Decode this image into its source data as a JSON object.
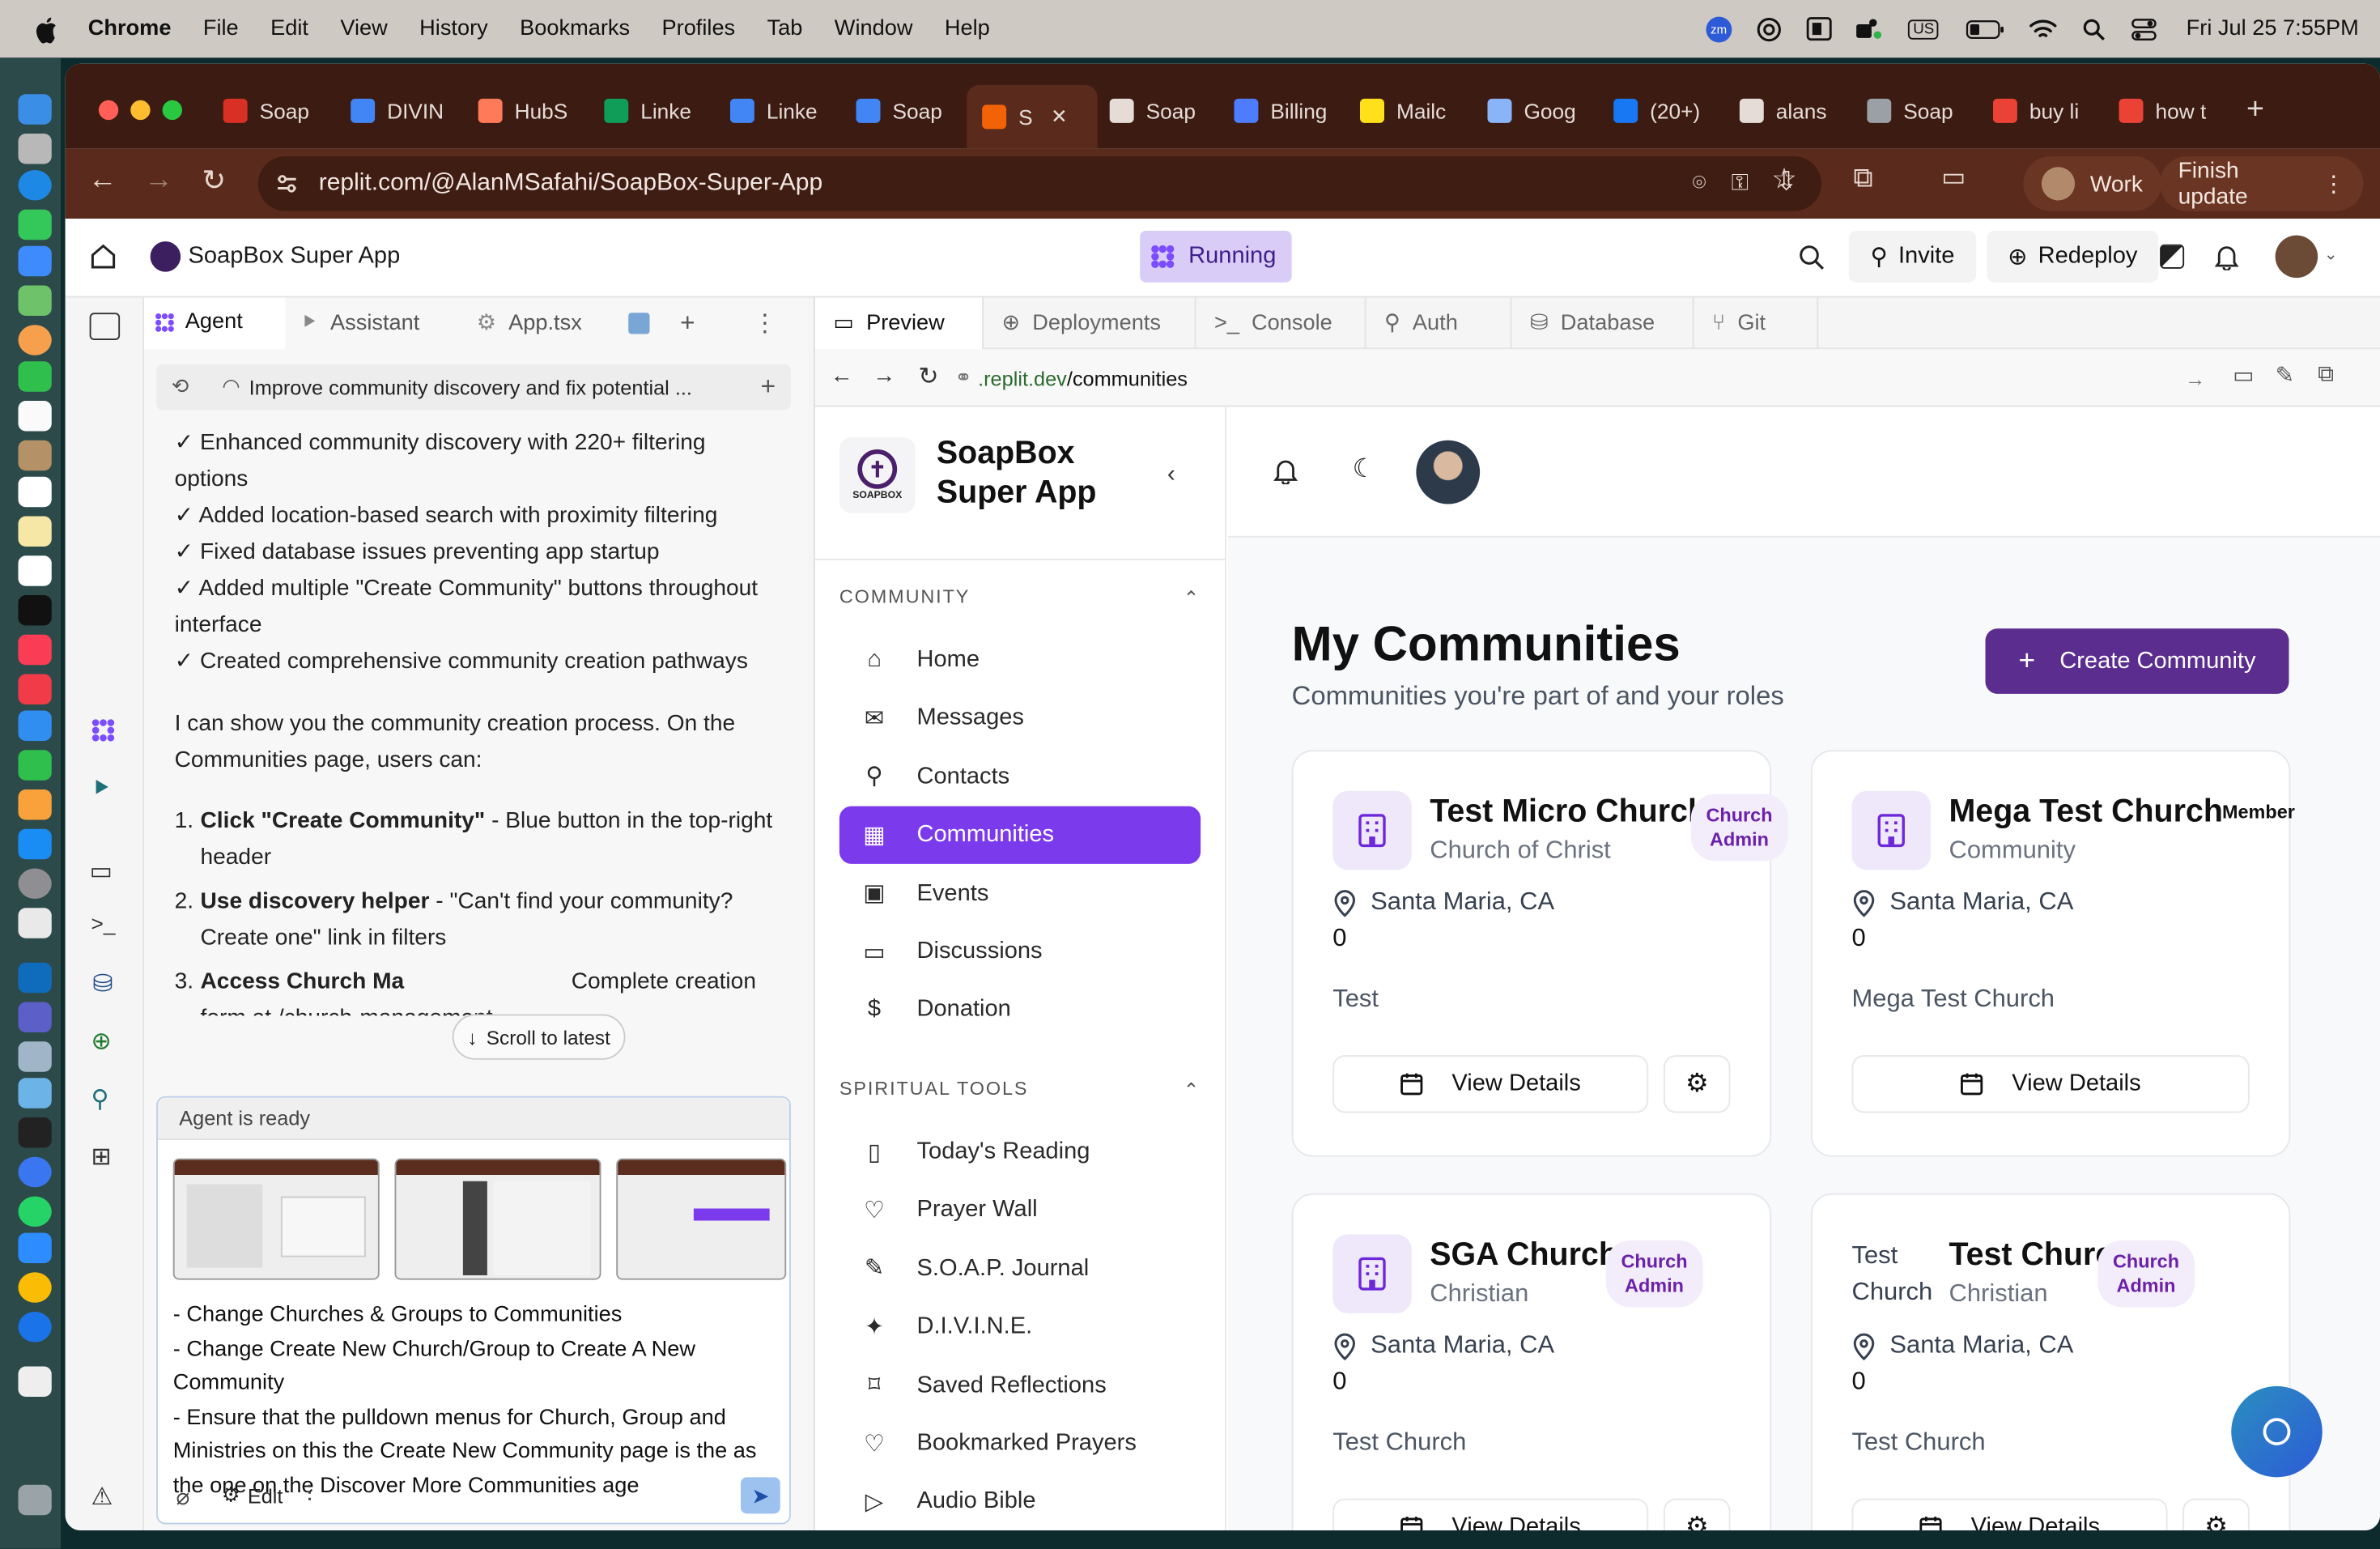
{
  "menubar": {
    "app": "Chrome",
    "items": [
      "File",
      "Edit",
      "View",
      "History",
      "Bookmarks",
      "Profiles",
      "Tab",
      "Window",
      "Help"
    ],
    "status": {
      "zoom_badge": "zm",
      "input_source": "US",
      "datetime": "Fri Jul 25  7:55PM"
    }
  },
  "tabs": [
    {
      "label": "Soap",
      "color": "#d93025"
    },
    {
      "label": "DIVIN",
      "color": "#4285f4"
    },
    {
      "label": "HubS",
      "color": "#ff7a59"
    },
    {
      "label": "Linke",
      "color": "#0f9d58"
    },
    {
      "label": "Linke",
      "color": "#4285f4"
    },
    {
      "label": "Soap",
      "color": "#4285f4"
    },
    {
      "label": "S",
      "color": "#f26207"
    },
    {
      "label": "Soap",
      "color": "#e6dcd7"
    },
    {
      "label": "Billing",
      "color": "#4d7cfe"
    },
    {
      "label": "Mailc",
      "color": "#ffe01b"
    },
    {
      "label": "Goog",
      "color": "#8ab4f8"
    },
    {
      "label": "(20+)",
      "color": "#1877f2"
    },
    {
      "label": "alans",
      "color": "#e6dcd7"
    },
    {
      "label": "Soap",
      "color": "#9aa0a6"
    },
    {
      "label": "buy li",
      "color": "#ea4335"
    },
    {
      "label": "how t",
      "color": "#ea4335"
    }
  ],
  "toolbar": {
    "url": "replit.com/@AlanMSafahi/SoapBox-Super-App",
    "profile_label": "Work",
    "update_label": "Finish update"
  },
  "replit": {
    "project": "SoapBox Super App",
    "status": "Running",
    "invite": "Invite",
    "redeploy": "Redeploy"
  },
  "agent": {
    "tabs": [
      "Agent",
      "Assistant",
      "App.tsx"
    ],
    "thread_title": "Improve community discovery and fix potential ...",
    "checklist": [
      "✓ Enhanced community discovery with 220+ filtering options",
      "✓ Added location-based search with proximity filtering",
      "✓ Fixed database issues preventing app startup",
      "✓ Added multiple \"Create Community\" buttons throughout interface",
      "✓ Created comprehensive community creation pathways"
    ],
    "intro": "I can show you the community creation process. On the Communities page, users can:",
    "steps": [
      {
        "n": "1.",
        "bold": "Click \"Create Community\"",
        "rest": " - Blue button in the top-right header"
      },
      {
        "n": "2.",
        "bold": "Use discovery helper",
        "rest": " - \"Can't find your community? Create one\" link in filters"
      },
      {
        "n": "3.",
        "bold": "Access Church Ma",
        "rest": " Complete creation form at /church-management"
      }
    ],
    "scroll_label": "Scroll to latest",
    "ready": "Agent is ready",
    "draft": [
      "- Change Churches & Groups to Communities",
      "- Change Create New Church/Group to Create A New Community",
      "- Ensure that the pulldown menus for Church, Group and Ministries on this the Create New Community page  is the as the one on the Discover More Communities age"
    ],
    "edit_label": "Edit"
  },
  "preview": {
    "tabs": [
      "Preview",
      "Deployments",
      "Console",
      "Auth",
      "Database",
      "Git"
    ],
    "address_domain": ".replit.dev",
    "address_path": "/communities"
  },
  "app": {
    "brand_line1": "SoapBox",
    "brand_line2": "Super App",
    "logo_text": "SOAPBOX",
    "community_heading": "COMMUNITY",
    "community_items": [
      "Home",
      "Messages",
      "Contacts",
      "Communities",
      "Events",
      "Discussions",
      "Donation"
    ],
    "tools_heading": "SPIRITUAL TOOLS",
    "tools_items": [
      "Today's Reading",
      "Prayer Wall",
      "S.O.A.P. Journal",
      "D.I.V.I.N.E.",
      "Saved Reflections",
      "Bookmarked Prayers",
      "Audio Bible"
    ],
    "page_title": "My Communities",
    "page_subtitle": "Communities you're part of and your roles",
    "create_button": "Create Community",
    "accent": "#5b2d8e",
    "active_nav": "#7c3aed"
  },
  "cards": [
    {
      "name": "Test Micro Church",
      "type": "Church of Christ",
      "role_line1": "Church",
      "role_line2": "Admin",
      "location": "Santa Maria, CA",
      "count": "0",
      "description": "Test",
      "button": "View Details"
    },
    {
      "name": "Mega Test Church",
      "type": "Community",
      "role_line1": "Member",
      "role_line2": "",
      "location": "Santa Maria, CA",
      "count": "0",
      "description": "Mega Test Church",
      "button": "View Details"
    },
    {
      "name": "SGA Church",
      "type": "Christian",
      "role_line1": "Church",
      "role_line2": "Admin",
      "location": "Santa Maria, CA",
      "count": "0",
      "description": "Test Church",
      "button": "View Details"
    },
    {
      "name": "Test Church",
      "type": "Christian",
      "role_line1": "Church",
      "role_line2": "Admin",
      "location": "Santa Maria, CA",
      "count": "0",
      "description": "Test Church",
      "button": "View Details",
      "broken_image_alt": "Test Church"
    }
  ]
}
